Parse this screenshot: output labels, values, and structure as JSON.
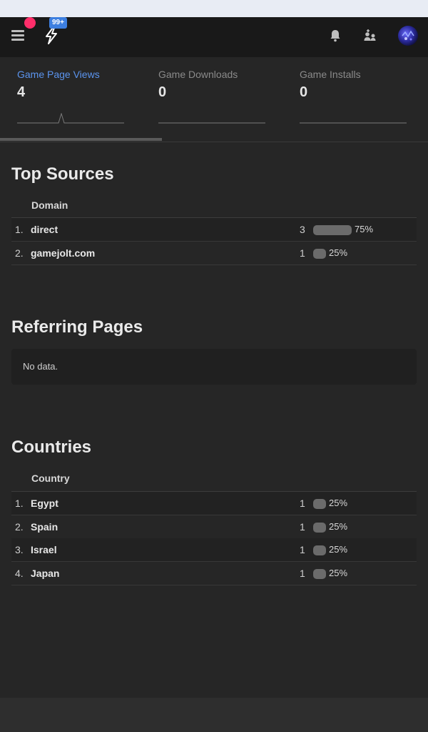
{
  "header": {
    "notification_badge": "99+",
    "icons": [
      "menu-icon",
      "gamejolt-logo-icon",
      "bell-icon",
      "friends-icon",
      "avatar"
    ]
  },
  "stats_tabs": [
    {
      "label": "Game Page Views",
      "value": "4"
    },
    {
      "label": "Game Downloads",
      "value": "0"
    },
    {
      "label": "Game Installs",
      "value": "0"
    }
  ],
  "top_sources": {
    "title": "Top Sources",
    "column": "Domain",
    "rows": [
      {
        "rank": "1.",
        "name": "direct",
        "count": "3",
        "percent": "75%",
        "fraction": 0.75
      },
      {
        "rank": "2.",
        "name": "gamejolt.com",
        "count": "1",
        "percent": "25%",
        "fraction": 0.25
      }
    ]
  },
  "referring_pages": {
    "title": "Referring Pages",
    "empty_text": "No data."
  },
  "countries": {
    "title": "Countries",
    "column": "Country",
    "rows": [
      {
        "rank": "1.",
        "name": "Egypt",
        "count": "1",
        "percent": "25%",
        "fraction": 0.25
      },
      {
        "rank": "2.",
        "name": "Spain",
        "count": "1",
        "percent": "25%",
        "fraction": 0.25
      },
      {
        "rank": "3.",
        "name": "Israel",
        "count": "1",
        "percent": "25%",
        "fraction": 0.25
      },
      {
        "rank": "4.",
        "name": "Japan",
        "count": "1",
        "percent": "25%",
        "fraction": 0.25
      }
    ]
  },
  "colors": {
    "accent": "#5b94ee",
    "background": "#262626",
    "topbar": "#191919",
    "notification_dot": "#ff2e6a",
    "badge": "#3d7fe0"
  }
}
